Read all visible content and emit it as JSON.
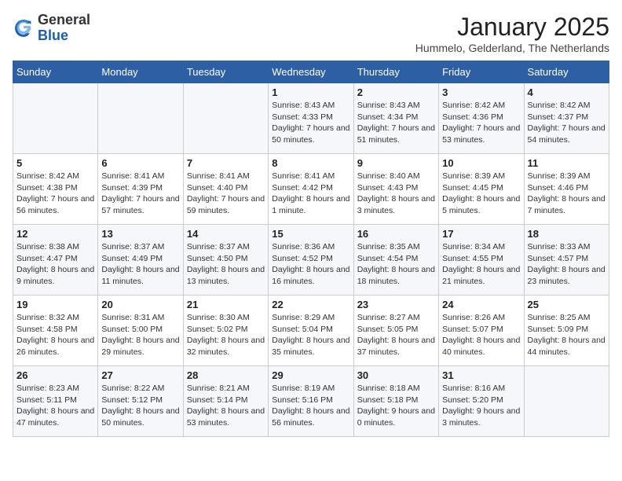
{
  "logo": {
    "general": "General",
    "blue": "Blue"
  },
  "title": "January 2025",
  "subtitle": "Hummelo, Gelderland, The Netherlands",
  "weekdays": [
    "Sunday",
    "Monday",
    "Tuesday",
    "Wednesday",
    "Thursday",
    "Friday",
    "Saturday"
  ],
  "weeks": [
    [
      {
        "day": null,
        "info": null
      },
      {
        "day": null,
        "info": null
      },
      {
        "day": null,
        "info": null
      },
      {
        "day": "1",
        "sunrise": "8:43 AM",
        "sunset": "4:33 PM",
        "daylight": "7 hours and 50 minutes."
      },
      {
        "day": "2",
        "sunrise": "8:43 AM",
        "sunset": "4:34 PM",
        "daylight": "7 hours and 51 minutes."
      },
      {
        "day": "3",
        "sunrise": "8:42 AM",
        "sunset": "4:36 PM",
        "daylight": "7 hours and 53 minutes."
      },
      {
        "day": "4",
        "sunrise": "8:42 AM",
        "sunset": "4:37 PM",
        "daylight": "7 hours and 54 minutes."
      }
    ],
    [
      {
        "day": "5",
        "sunrise": "8:42 AM",
        "sunset": "4:38 PM",
        "daylight": "7 hours and 56 minutes."
      },
      {
        "day": "6",
        "sunrise": "8:41 AM",
        "sunset": "4:39 PM",
        "daylight": "7 hours and 57 minutes."
      },
      {
        "day": "7",
        "sunrise": "8:41 AM",
        "sunset": "4:40 PM",
        "daylight": "7 hours and 59 minutes."
      },
      {
        "day": "8",
        "sunrise": "8:41 AM",
        "sunset": "4:42 PM",
        "daylight": "8 hours and 1 minute."
      },
      {
        "day": "9",
        "sunrise": "8:40 AM",
        "sunset": "4:43 PM",
        "daylight": "8 hours and 3 minutes."
      },
      {
        "day": "10",
        "sunrise": "8:39 AM",
        "sunset": "4:45 PM",
        "daylight": "8 hours and 5 minutes."
      },
      {
        "day": "11",
        "sunrise": "8:39 AM",
        "sunset": "4:46 PM",
        "daylight": "8 hours and 7 minutes."
      }
    ],
    [
      {
        "day": "12",
        "sunrise": "8:38 AM",
        "sunset": "4:47 PM",
        "daylight": "8 hours and 9 minutes."
      },
      {
        "day": "13",
        "sunrise": "8:37 AM",
        "sunset": "4:49 PM",
        "daylight": "8 hours and 11 minutes."
      },
      {
        "day": "14",
        "sunrise": "8:37 AM",
        "sunset": "4:50 PM",
        "daylight": "8 hours and 13 minutes."
      },
      {
        "day": "15",
        "sunrise": "8:36 AM",
        "sunset": "4:52 PM",
        "daylight": "8 hours and 16 minutes."
      },
      {
        "day": "16",
        "sunrise": "8:35 AM",
        "sunset": "4:54 PM",
        "daylight": "8 hours and 18 minutes."
      },
      {
        "day": "17",
        "sunrise": "8:34 AM",
        "sunset": "4:55 PM",
        "daylight": "8 hours and 21 minutes."
      },
      {
        "day": "18",
        "sunrise": "8:33 AM",
        "sunset": "4:57 PM",
        "daylight": "8 hours and 23 minutes."
      }
    ],
    [
      {
        "day": "19",
        "sunrise": "8:32 AM",
        "sunset": "4:58 PM",
        "daylight": "8 hours and 26 minutes."
      },
      {
        "day": "20",
        "sunrise": "8:31 AM",
        "sunset": "5:00 PM",
        "daylight": "8 hours and 29 minutes."
      },
      {
        "day": "21",
        "sunrise": "8:30 AM",
        "sunset": "5:02 PM",
        "daylight": "8 hours and 32 minutes."
      },
      {
        "day": "22",
        "sunrise": "8:29 AM",
        "sunset": "5:04 PM",
        "daylight": "8 hours and 35 minutes."
      },
      {
        "day": "23",
        "sunrise": "8:27 AM",
        "sunset": "5:05 PM",
        "daylight": "8 hours and 37 minutes."
      },
      {
        "day": "24",
        "sunrise": "8:26 AM",
        "sunset": "5:07 PM",
        "daylight": "8 hours and 40 minutes."
      },
      {
        "day": "25",
        "sunrise": "8:25 AM",
        "sunset": "5:09 PM",
        "daylight": "8 hours and 44 minutes."
      }
    ],
    [
      {
        "day": "26",
        "sunrise": "8:23 AM",
        "sunset": "5:11 PM",
        "daylight": "8 hours and 47 minutes."
      },
      {
        "day": "27",
        "sunrise": "8:22 AM",
        "sunset": "5:12 PM",
        "daylight": "8 hours and 50 minutes."
      },
      {
        "day": "28",
        "sunrise": "8:21 AM",
        "sunset": "5:14 PM",
        "daylight": "8 hours and 53 minutes."
      },
      {
        "day": "29",
        "sunrise": "8:19 AM",
        "sunset": "5:16 PM",
        "daylight": "8 hours and 56 minutes."
      },
      {
        "day": "30",
        "sunrise": "8:18 AM",
        "sunset": "5:18 PM",
        "daylight": "9 hours and 0 minutes."
      },
      {
        "day": "31",
        "sunrise": "8:16 AM",
        "sunset": "5:20 PM",
        "daylight": "9 hours and 3 minutes."
      },
      {
        "day": null,
        "info": null
      }
    ]
  ]
}
